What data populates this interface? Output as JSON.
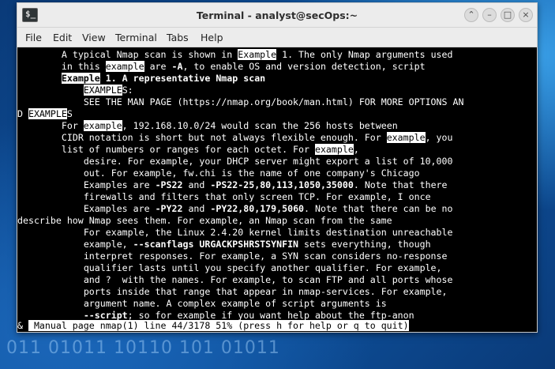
{
  "desktop": {
    "binary_text": "011 01011 10110 101 01011"
  },
  "window": {
    "title": "Terminal - analyst@secOps:~",
    "app_icon_glyph": "$_",
    "buttons": {
      "up": "⌃",
      "minimize": "–",
      "maximize": "□",
      "close": "×"
    }
  },
  "menu": {
    "file": "File",
    "edit": "Edit",
    "view": "View",
    "terminal": "Terminal",
    "tabs": "Tabs",
    "help": "Help"
  },
  "terminal": {
    "lines": [
      {
        "indent": 8,
        "segments": [
          {
            "t": "A typical Nmap scan is shown in "
          },
          {
            "t": "Example",
            "s": "hl"
          },
          {
            "t": " 1. The only Nmap arguments used"
          }
        ]
      },
      {
        "indent": 8,
        "segments": [
          {
            "t": "in this "
          },
          {
            "t": "example",
            "s": "hl"
          },
          {
            "t": " are "
          },
          {
            "t": "-A",
            "s": "b"
          },
          {
            "t": ", to enable OS and version detection, script"
          }
        ]
      },
      {
        "indent": 8,
        "segments": [
          {
            "t": "Example",
            "s": "hl b"
          },
          {
            "t": " 1. A representative Nmap scan",
            "s": "b"
          }
        ]
      },
      {
        "indent": 12,
        "segments": [
          {
            "t": "EXAMPLE",
            "s": "hl"
          },
          {
            "t": "S:"
          }
        ]
      },
      {
        "indent": 12,
        "segments": [
          {
            "t": "SEE THE MAN PAGE (https://nmap.org/book/man.html) FOR MORE OPTIONS AN"
          }
        ]
      },
      {
        "indent": 0,
        "segments": [
          {
            "t": "D "
          },
          {
            "t": "EXAMPLE",
            "s": "hl"
          },
          {
            "t": "S"
          }
        ]
      },
      {
        "indent": 8,
        "segments": [
          {
            "t": "For "
          },
          {
            "t": "example",
            "s": "hl"
          },
          {
            "t": ", 192.168.10.0/24 would scan the 256 hosts between"
          }
        ]
      },
      {
        "indent": 8,
        "segments": [
          {
            "t": "CIDR notation is short but not always flexible enough. For "
          },
          {
            "t": "example",
            "s": "hl"
          },
          {
            "t": ", you"
          }
        ]
      },
      {
        "indent": 8,
        "segments": [
          {
            "t": "list of numbers or ranges for each octet. For "
          },
          {
            "t": "example",
            "s": "hl"
          },
          {
            "t": ","
          }
        ]
      },
      {
        "indent": 12,
        "segments": [
          {
            "t": "desire. For example, your DHCP server might export a list of 10,000"
          }
        ]
      },
      {
        "indent": 12,
        "segments": [
          {
            "t": "out. For example, fw.chi is the name of one company's Chicago"
          }
        ]
      },
      {
        "indent": 12,
        "segments": [
          {
            "t": "Examples are "
          },
          {
            "t": "-PS22",
            "s": "b"
          },
          {
            "t": " and "
          },
          {
            "t": "-PS22-25,80,113,1050,35000",
            "s": "b"
          },
          {
            "t": ". Note that there"
          }
        ]
      },
      {
        "indent": 12,
        "segments": [
          {
            "t": "firewalls and filters that only screen TCP. For example, I once"
          }
        ]
      },
      {
        "indent": 12,
        "segments": [
          {
            "t": "Examples are "
          },
          {
            "t": "-PY22",
            "s": "b"
          },
          {
            "t": " and "
          },
          {
            "t": "-PY22,80,179,5060",
            "s": "b"
          },
          {
            "t": ". Note that there can be no"
          }
        ]
      },
      {
        "indent": 0,
        "segments": [
          {
            "t": "describe how Nmap sees them. For example, an Nmap scan from the same"
          }
        ]
      },
      {
        "indent": 12,
        "segments": [
          {
            "t": "For example, the Linux 2.4.20 kernel limits destination unreachable"
          }
        ]
      },
      {
        "indent": 12,
        "segments": [
          {
            "t": "example, "
          },
          {
            "t": "--scanflags URGACKPSHRSTSYNFIN",
            "s": "b"
          },
          {
            "t": " sets everything, though"
          }
        ]
      },
      {
        "indent": 12,
        "segments": [
          {
            "t": "interpret responses. For example, a SYN scan considers no-response"
          }
        ]
      },
      {
        "indent": 12,
        "segments": [
          {
            "t": "qualifier lasts until you specify another qualifier. For example,"
          }
        ]
      },
      {
        "indent": 12,
        "segments": [
          {
            "t": "and ?  with the names. For example, to scan FTP and all ports whose"
          }
        ]
      },
      {
        "indent": 12,
        "segments": [
          {
            "t": "ports inside that range that appear in nmap-services. For example,"
          }
        ]
      },
      {
        "indent": 12,
        "segments": [
          {
            "t": "argument name. A complex example of script arguments is"
          }
        ]
      },
      {
        "indent": 12,
        "segments": [
          {
            "t": "--script",
            "s": "b"
          },
          {
            "t": "; so for example if you want help about the ftp-anon"
          }
        ]
      }
    ],
    "status_prefix": "& ",
    "status_text": " Manual page nmap(1) line 44/3178 51% (press h for help or q to quit)"
  }
}
